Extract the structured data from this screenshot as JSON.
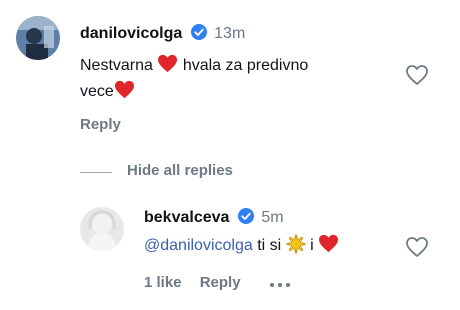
{
  "comment": {
    "username": "danilovicolga",
    "time": "13m",
    "text_part1": "Nestvarna",
    "text_part2": "hvala za predivno",
    "text_part3": "vece",
    "reply_label": "Reply",
    "like_icon": "heart-outline-icon"
  },
  "replies_toggle": {
    "label": "Hide all replies"
  },
  "reply": {
    "username": "bekvalceva",
    "time": "5m",
    "mention": "@danilovicolga",
    "text_part1": "ti si",
    "text_part2": "i",
    "likes_label": "1 like",
    "reply_label": "Reply",
    "more_icon": "more-dots-icon"
  },
  "colors": {
    "heart": "#e0262b",
    "verified": "#2f7ef6",
    "muted": "#6d7a86",
    "mention": "#3a5fb0",
    "sun": "#f2c31a"
  }
}
